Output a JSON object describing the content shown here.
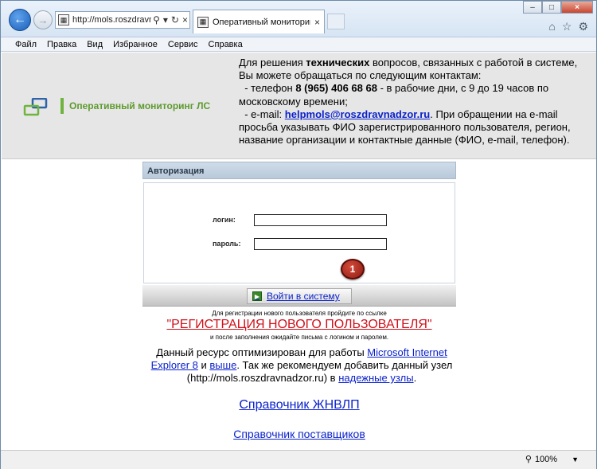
{
  "browser": {
    "address": "http://mols.roszdravn...",
    "tab_title": "Оперативный мониторинг ЛС",
    "menu": [
      "Файл",
      "Правка",
      "Вид",
      "Избранное",
      "Сервис",
      "Справка"
    ],
    "zoom": "100%"
  },
  "header": {
    "logo_text": "Оперативный мониторинг ЛС",
    "contact_intro_1": "Для решения ",
    "contact_intro_bold": "технических",
    "contact_intro_2": " вопросов, связанных с работой в системе, Вы можете обращаться по следующим контактам:",
    "phone_prefix": "  - телефон ",
    "phone": "8 (965) 406 68 68",
    "phone_suffix": " - в рабочие дни, с 9 до 19 часов по московскому времени;",
    "email_prefix": "  - e-mail: ",
    "email": "helpmols@roszdravnadzor.ru",
    "email_suffix": ". При обращении на e-mail просьба указывать ФИО зарегистрированного пользователя, регион, название организации и контактные данные (ФИО, e-mail, телефон)."
  },
  "auth": {
    "title": "Авторизация",
    "login_label": "логин:",
    "password_label": "пароль:",
    "login_value": "",
    "password_value": "",
    "marker": "1",
    "submit_label": "Войти в систему"
  },
  "registration": {
    "hint_before": "Для регистрации нового пользователя пройдите по ссылке",
    "link": "\"РЕГИСТРАЦИЯ НОВОГО ПОЛЬЗОВАТЕЛЯ\"",
    "hint_after": "и после заполнения ожидайте письма с логином и паролем."
  },
  "optimization": {
    "part1": "Данный ресурс оптимизирован для работы ",
    "link_ie": "Microsoft Internet Explorer 8",
    "part2": " и ",
    "link_higher": "выше",
    "part3": ". Так же рекомендуем добавить данный узел (http://mols.roszdravnadzor.ru) в ",
    "link_trusted": "надежные узлы",
    "part4": "."
  },
  "links": {
    "zhnvlp": "Справочник ЖНВЛП",
    "suppliers": "Справочник поставщиков"
  }
}
